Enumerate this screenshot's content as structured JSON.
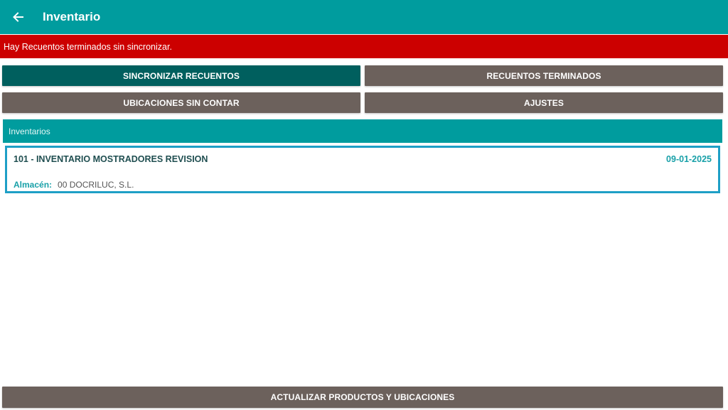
{
  "appbar": {
    "title": "Inventario",
    "back_icon": "arrow-left-icon"
  },
  "warning": {
    "text": "Hay Recuentos terminados sin sincronizar."
  },
  "buttons": {
    "sync": "SINCRONIZAR RECUENTOS",
    "finished": "RECUENTOS TERMINADOS",
    "uncounted": "UBICACIONES SIN CONTAR",
    "settings": "AJUSTES",
    "update": "ACTUALIZAR PRODUCTOS Y UBICACIONES"
  },
  "section": {
    "title": "Inventarios"
  },
  "inventories": [
    {
      "title": "101 - INVENTARIO MOSTRADORES REVISION",
      "date": "09-01-2025",
      "warehouse_label": "Almacén:",
      "warehouse_value": "00 DOCRILUC, S.L."
    }
  ],
  "colors": {
    "primary": "#009C9E",
    "primary_dark": "#005F5E",
    "warning": "#CC0000",
    "button_gray": "#6C615C",
    "accent": "#1E9FC6"
  }
}
